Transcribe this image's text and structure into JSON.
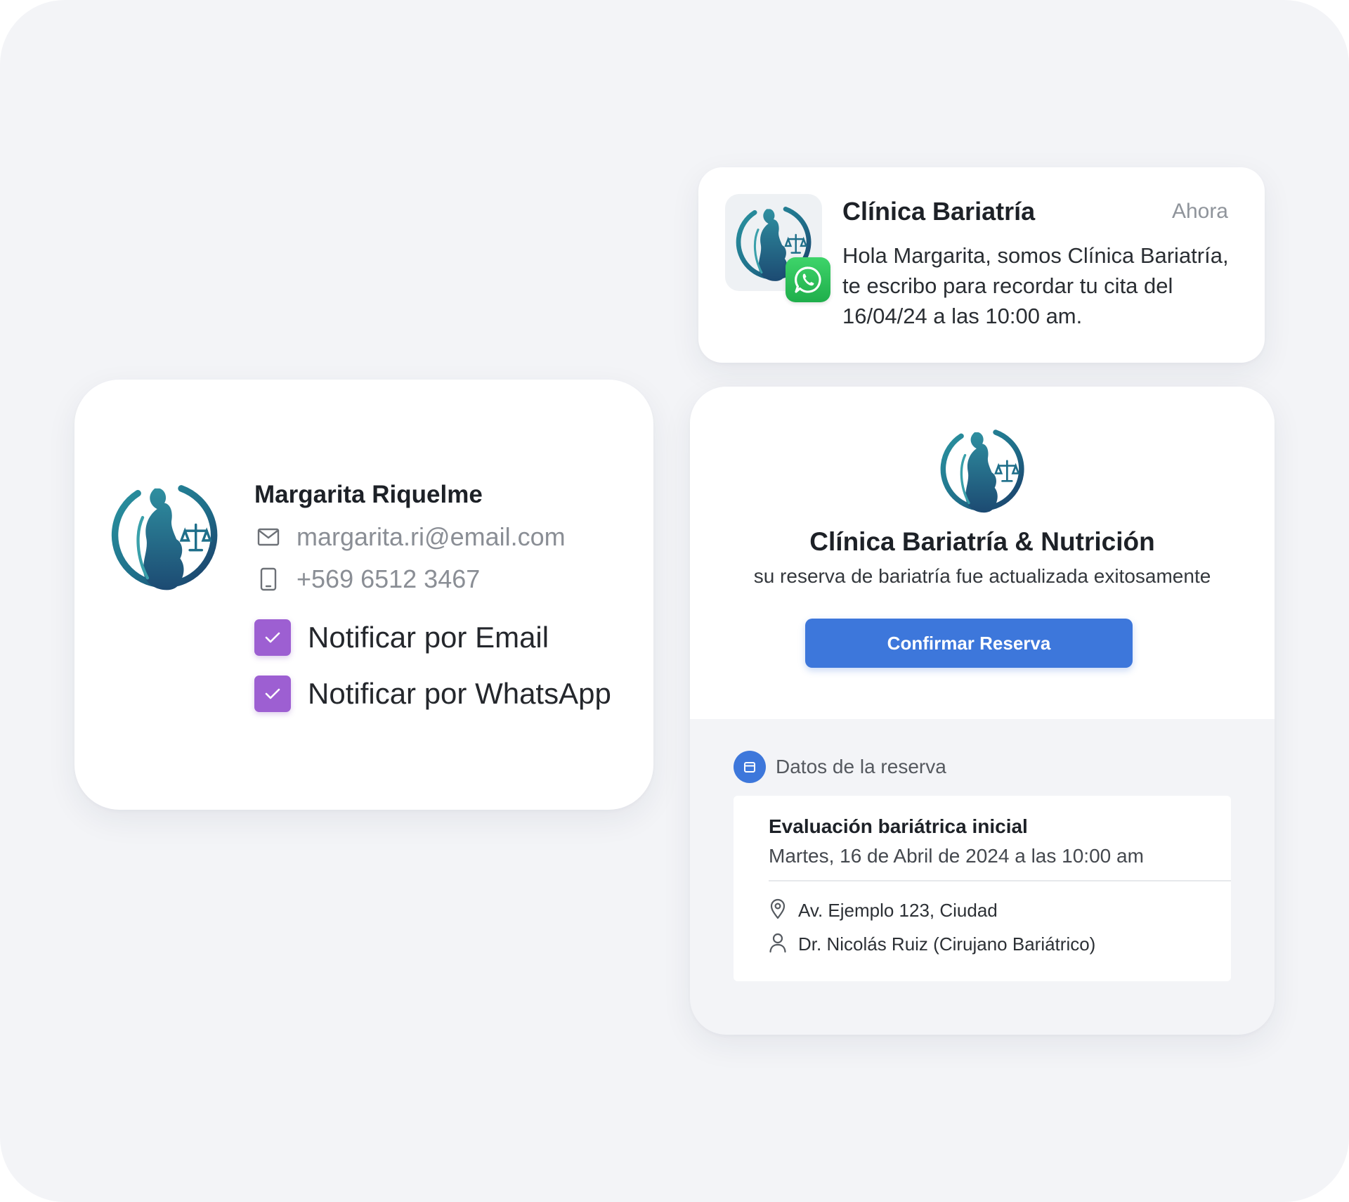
{
  "patient": {
    "name": "Margarita Riquelme",
    "email": "margarita.ri@email.com",
    "phone": "+569 6512 3467",
    "options": [
      {
        "label": "Notificar por Email",
        "checked": true
      },
      {
        "label": "Notificar por WhatsApp",
        "checked": true
      }
    ]
  },
  "notification": {
    "sender": "Clínica Bariatría",
    "time": "Ahora",
    "message": "Hola Margarita, somos Clínica Bariatría, te escribo para recordar tu cita del 16/04/24 a las 10:00 am.",
    "channel_icon": "whatsapp-icon"
  },
  "confirmation": {
    "clinic_name": "Clínica Bariatría & Nutrición",
    "subtitle": "su reserva de bariatría fue actualizada exitosamente",
    "button_label": "Confirmar Reserva",
    "section_title": "Datos de la reserva",
    "booking": {
      "service": "Evaluación bariátrica inicial",
      "datetime": "Martes, 16 de Abril de 2024 a las 10:00 am",
      "address": "Av. Ejemplo 123, Ciudad",
      "doctor": "Dr. Nicolás Ruiz (Cirujano Bariátrico)"
    }
  },
  "colors": {
    "checkbox": "#9d5fd2",
    "primary_button": "#3d77db",
    "whatsapp": "#25c35a",
    "logo_teal": "#1f7d8f",
    "logo_navy": "#1d3f66"
  }
}
